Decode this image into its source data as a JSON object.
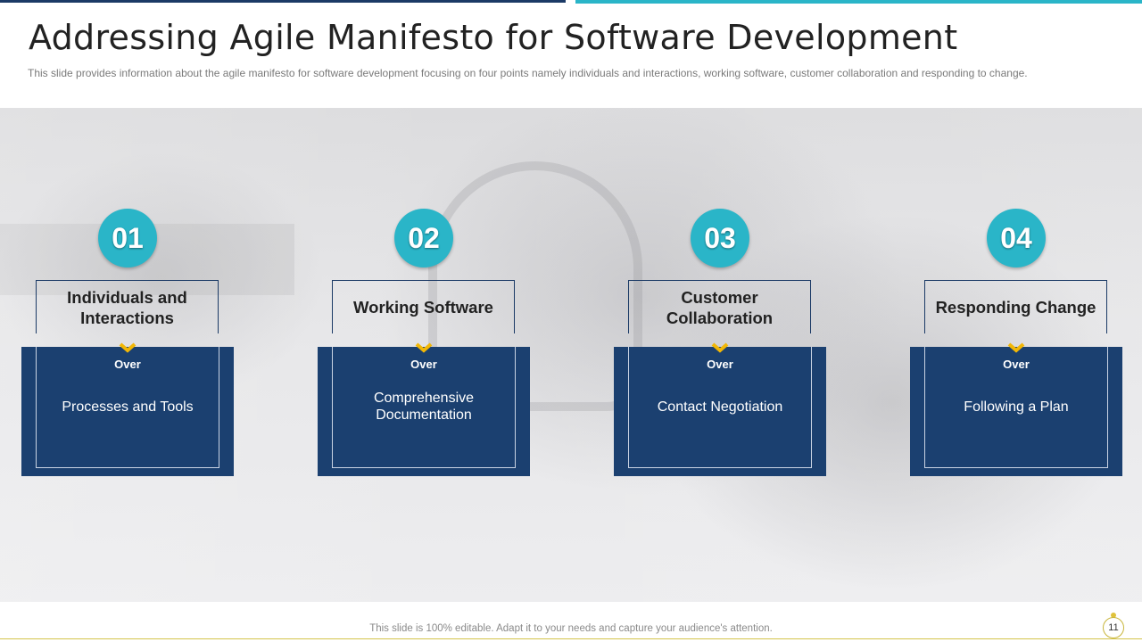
{
  "slide": {
    "title": "Addressing Agile Manifesto for Software Development",
    "subtitle": "This slide provides information about the agile manifesto for software development focusing on four points namely individuals and interactions, working software, customer collaboration and responding to change."
  },
  "cards": [
    {
      "number": "01",
      "heading": "Individuals and Interactions",
      "over": "Over",
      "description": "Processes and Tools"
    },
    {
      "number": "02",
      "heading": "Working Software",
      "over": "Over",
      "description": "Comprehensive Documentation"
    },
    {
      "number": "03",
      "heading": "Customer Collaboration",
      "over": "Over",
      "description": "Contact Negotiation"
    },
    {
      "number": "04",
      "heading": "Responding Change",
      "over": "Over",
      "description": "Following a Plan"
    }
  ],
  "footer": {
    "note": "This slide is 100% editable. Adapt it to your needs and capture your audience's attention.",
    "page_number": "11"
  },
  "colors": {
    "accent_teal": "#2ab5c8",
    "navy": "#1b4070",
    "chevron_gold": "#f2b705"
  },
  "icons": {
    "chevron": "chevron-down-icon",
    "background": "headphone-person-photo"
  }
}
